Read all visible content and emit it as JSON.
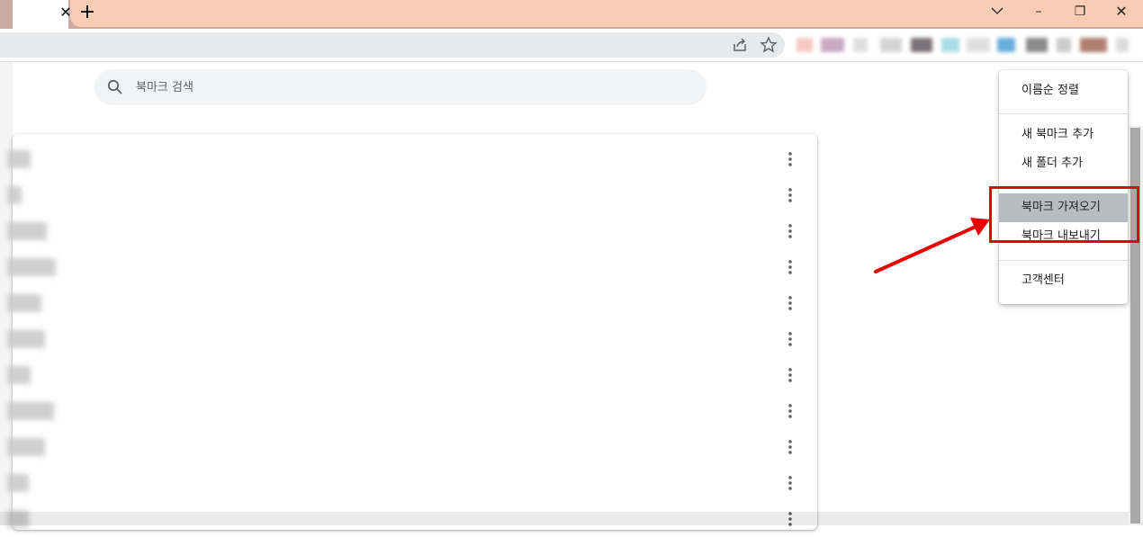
{
  "tabstrip": {
    "close_symbol": "✕",
    "new_tab_symbol": "+",
    "window_controls": {
      "dropdown_icon": "chevron-down-icon",
      "minimize": "–",
      "restore": "❐",
      "close": "✕"
    }
  },
  "toolbar": {
    "share_icon": "share-icon",
    "star_icon": "star-icon"
  },
  "search": {
    "placeholder": "북마크 검색"
  },
  "bookmarks": {
    "rows": [
      {
        "blur": 26
      },
      {
        "blur": 16
      },
      {
        "blur": 44
      },
      {
        "blur": 54
      },
      {
        "blur": 38
      },
      {
        "blur": 42
      },
      {
        "blur": 26
      },
      {
        "blur": 52
      },
      {
        "blur": 42
      },
      {
        "blur": 24
      },
      {
        "blur": 24
      }
    ],
    "row_menu_icon": "more-vert-icon"
  },
  "menu": {
    "sort_by_name": "이름순 정렬",
    "add_bookmark": "새 북마크 추가",
    "add_folder": "새 폴더 추가",
    "import_bookmarks": "북마크 가져오기",
    "export_bookmarks": "북마크 내보내기",
    "help_center": "고객센터"
  },
  "colors": {
    "tabstrip": "#cbaba0",
    "peach": "#f8cdb4",
    "highlight": "#b8bcc2",
    "annotation": "#e60000"
  }
}
